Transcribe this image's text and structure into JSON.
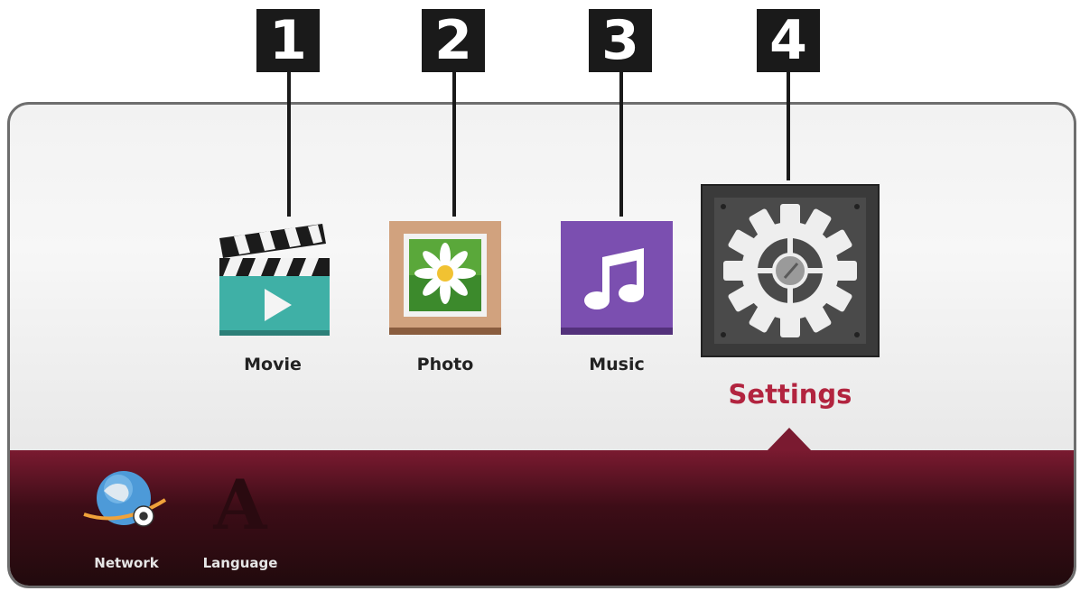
{
  "callouts": [
    "1",
    "2",
    "3",
    "4"
  ],
  "home_menu": {
    "items": [
      {
        "label": "Movie",
        "icon": "movie-clapper-icon"
      },
      {
        "label": "Photo",
        "icon": "photo-frame-icon"
      },
      {
        "label": "Music",
        "icon": "music-note-icon"
      },
      {
        "label": "Settings",
        "icon": "settings-gear-icon",
        "selected": true
      }
    ]
  },
  "submenu": {
    "items": [
      {
        "label": "Network",
        "icon": "network-globe-icon"
      },
      {
        "label": "Language",
        "icon": "language-letter-icon"
      }
    ]
  },
  "colors": {
    "selected_text": "#b2243f",
    "submenu_bar": "#3d0d17",
    "movie_tile": "#3fb0a6",
    "photo_tile": "#d1a27e",
    "music_tile": "#7b4fb0"
  }
}
